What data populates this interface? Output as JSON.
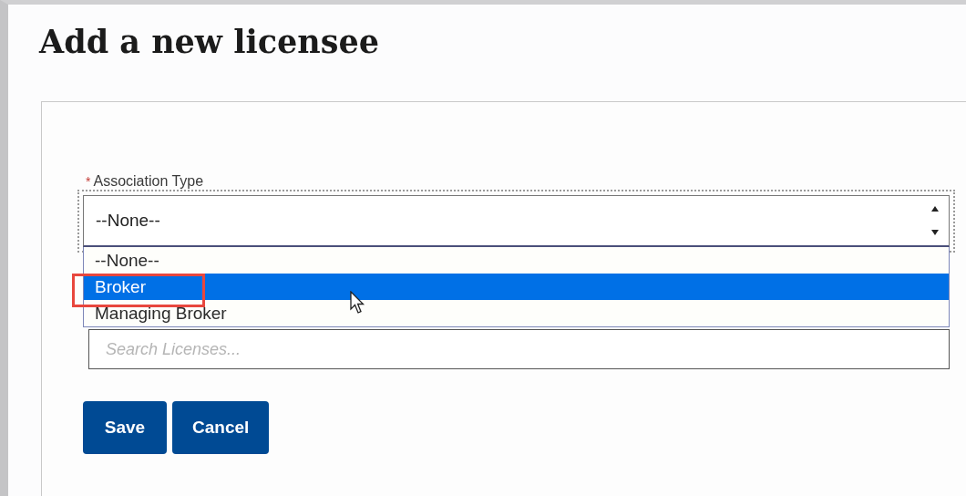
{
  "heading": "Add a new licensee",
  "association_type": {
    "required_mark": "*",
    "label": "Association Type",
    "value": "--None--",
    "expanded": true,
    "options": [
      {
        "label": "--None--",
        "highlighted": false
      },
      {
        "label": "Broker",
        "highlighted": true
      },
      {
        "label": "Managing Broker",
        "highlighted": false
      }
    ]
  },
  "search": {
    "placeholder": "Search Licenses..."
  },
  "buttons": [
    {
      "label": "Save"
    },
    {
      "label": "Cancel"
    }
  ]
}
